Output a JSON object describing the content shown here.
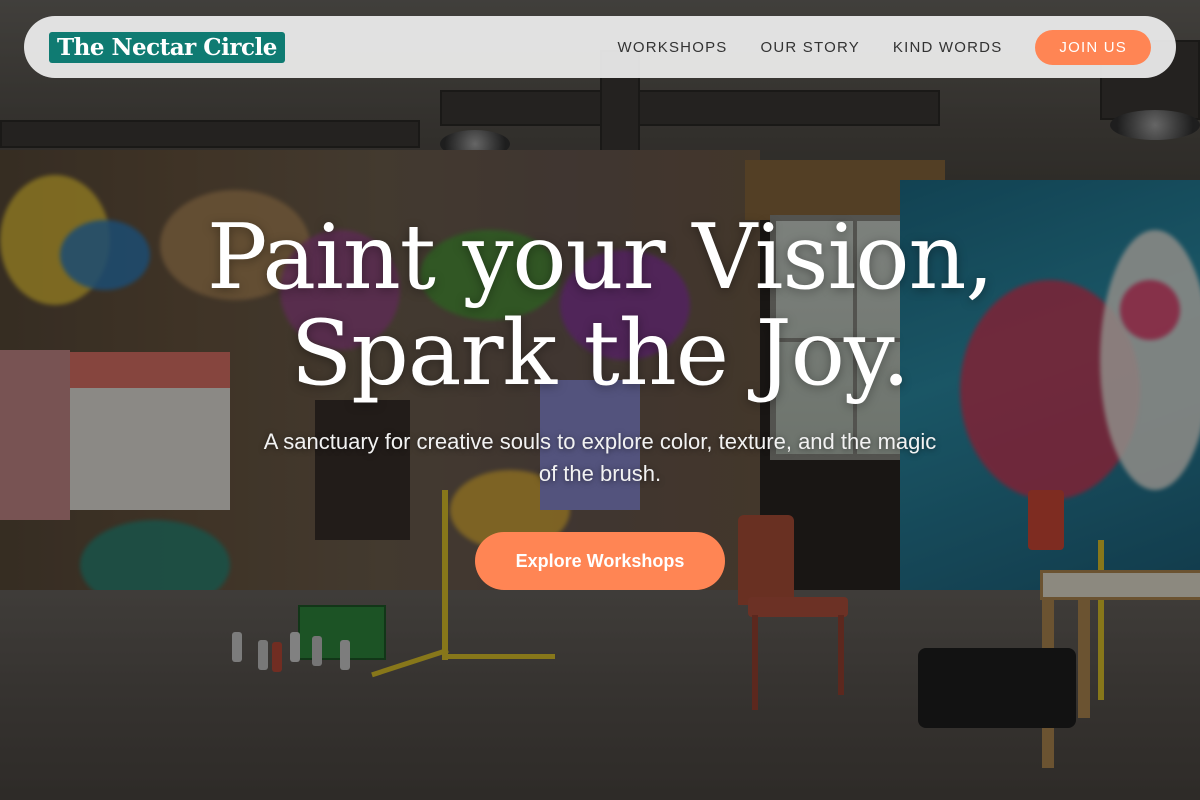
{
  "brand": {
    "name": "The Nectar Circle",
    "color": "#0f7b72"
  },
  "nav": {
    "links": [
      "WORKSHOPS",
      "OUR STORY",
      "KIND WORDS"
    ],
    "join_label": "JOIN US"
  },
  "hero": {
    "title_line1": "Paint your Vision,",
    "title_line2": "Spark the Joy.",
    "subtitle": "A sanctuary for creative souls to explore color, texture, and the magic of the brush.",
    "cta_label": "Explore Workshops"
  },
  "colors": {
    "accent": "#ff8554",
    "brand": "#0f7b72"
  }
}
